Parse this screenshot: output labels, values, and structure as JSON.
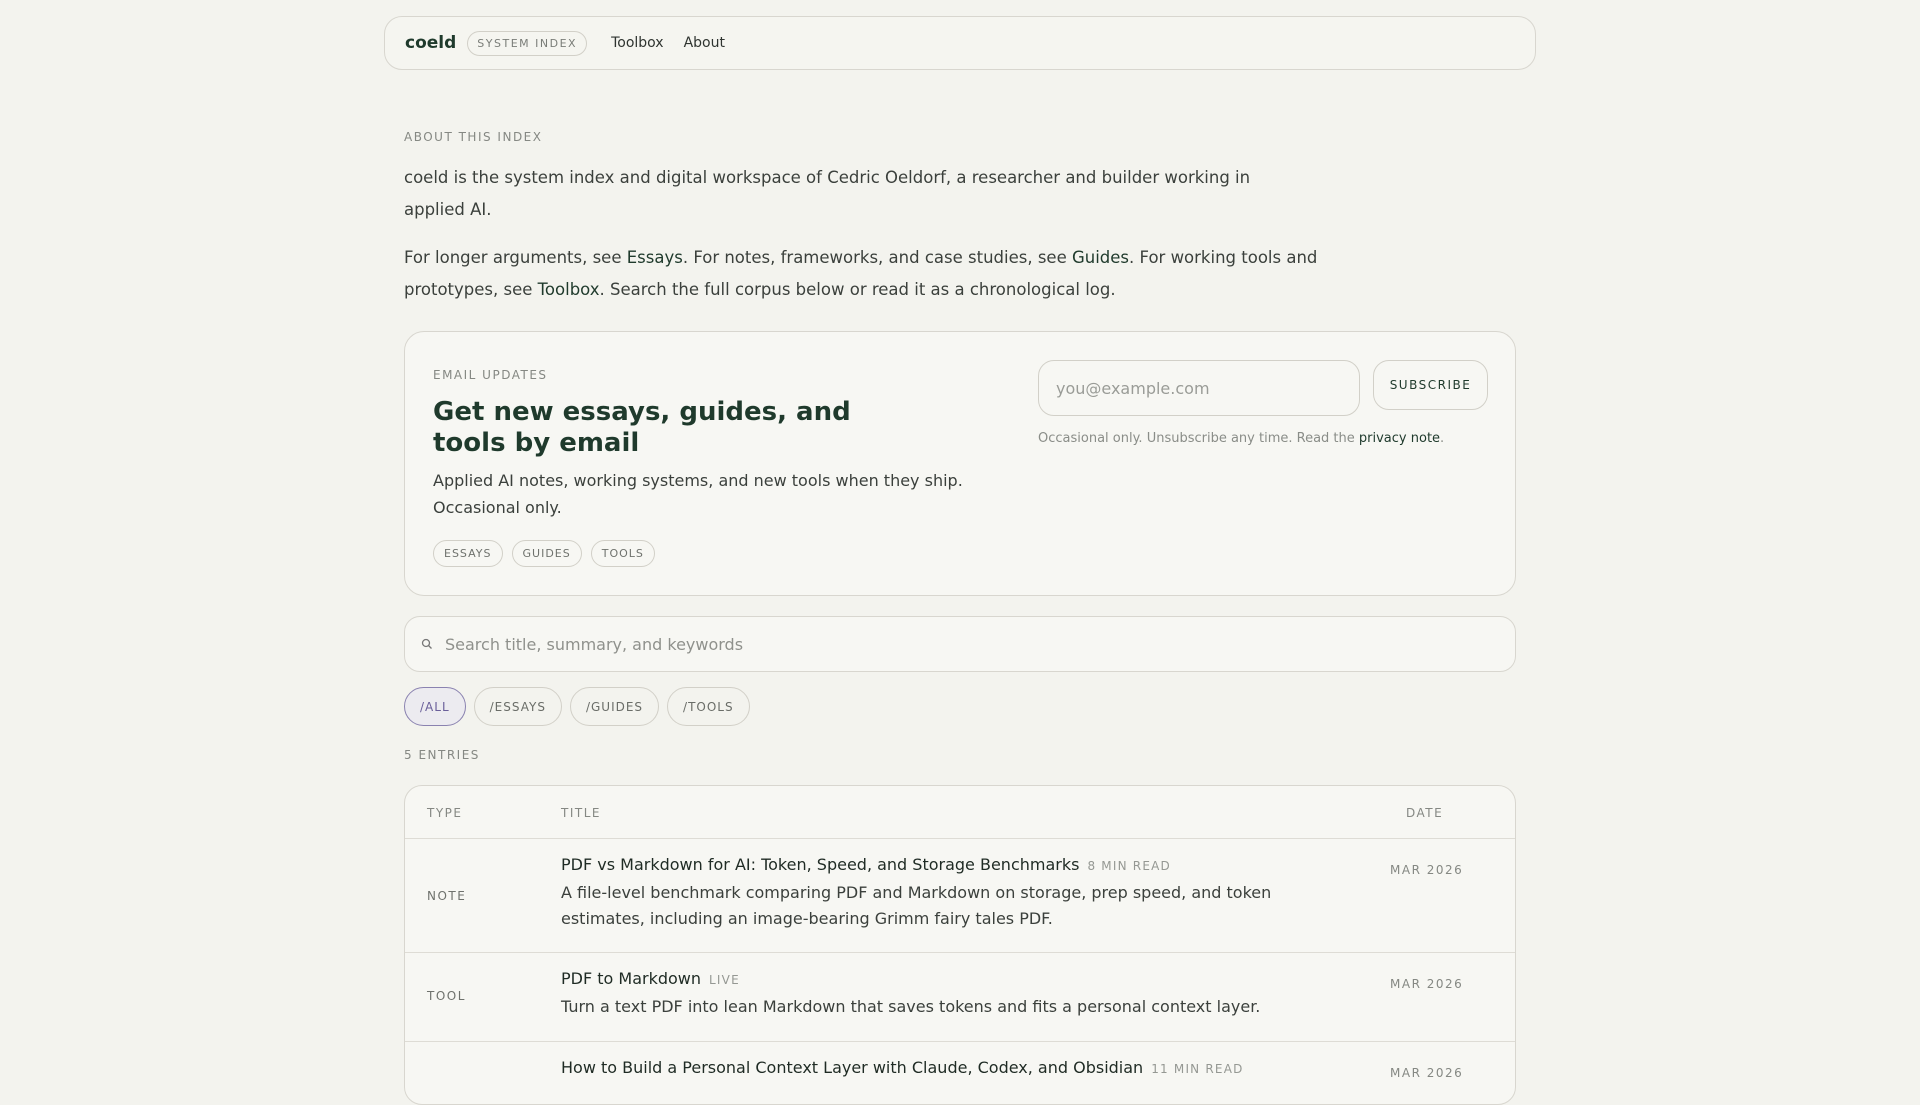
{
  "nav": {
    "logo": "coeld",
    "badge": "SYSTEM INDEX",
    "links": [
      "Toolbox",
      "About"
    ]
  },
  "about": {
    "label": "ABOUT THIS INDEX",
    "p1": "coeld is the system index and digital workspace of Cedric Oeldorf, a researcher and builder working in applied AI.",
    "p2": {
      "t1": "For longer arguments, see ",
      "l1": "Essays",
      "t2": ". For notes, frameworks, and case studies, see ",
      "l2": "Guides",
      "t3": ". For working tools and prototypes, see ",
      "l3": "Toolbox",
      "t4": ". Search the full corpus below or read it as a chronological log."
    }
  },
  "email": {
    "label": "EMAIL UPDATES",
    "heading": "Get new essays, guides, and tools by email",
    "desc": "Applied AI notes, working systems, and new tools when they ship. Occasional only.",
    "tags": [
      "ESSAYS",
      "GUIDES",
      "TOOLS"
    ],
    "placeholder": "you@example.com",
    "button": "SUBSCRIBE",
    "note": "Occasional only. Unsubscribe any time. Read the ",
    "note_link": "privacy note",
    "note_end": "."
  },
  "search": {
    "placeholder": "Search title, summary, and keywords"
  },
  "filters": [
    "/ALL",
    "/ESSAYS",
    "/GUIDES",
    "/TOOLS"
  ],
  "count": "5 ENTRIES",
  "table": {
    "headers": {
      "type": "TYPE",
      "title": "TITLE",
      "date": "DATE"
    },
    "rows": [
      {
        "type": "NOTE",
        "title": "PDF vs Markdown for AI: Token, Speed, and Storage Benchmarks",
        "meta": "8 MIN READ",
        "summary": "A file-level benchmark comparing PDF and Markdown on storage, prep speed, and token estimates, including an image-bearing Grimm fairy tales PDF.",
        "date": "MAR 2026"
      },
      {
        "type": "TOOL",
        "title": "PDF to Markdown",
        "meta": "LIVE",
        "summary": "Turn a text PDF into lean Markdown that saves tokens and fits a personal context layer.",
        "date": "MAR 2026"
      },
      {
        "type": "",
        "title": "How to Build a Personal Context Layer with Claude, Codex, and Obsidian",
        "meta": "11 MIN READ",
        "summary": "",
        "date": "MAR 2026"
      }
    ]
  }
}
